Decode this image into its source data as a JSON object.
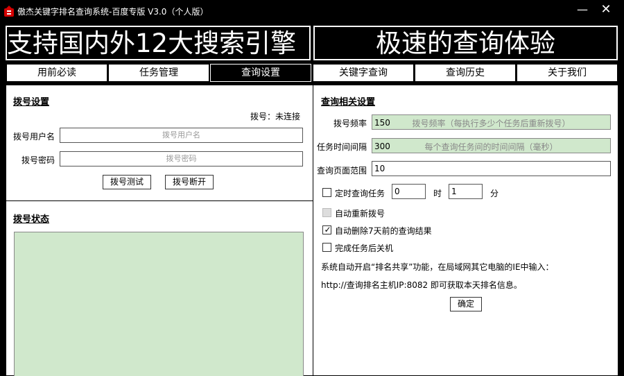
{
  "window": {
    "title": "傲杰关键字排名查询系统-百度专版 V3.0（个人版）",
    "minimize": "—",
    "close": "✕"
  },
  "banner": {
    "left_text": "支持国内外12大搜索引擎",
    "right_text": "极速的查询体验"
  },
  "tabs": [
    {
      "label": "用前必读"
    },
    {
      "label": "任务管理"
    },
    {
      "label": "查询设置"
    },
    {
      "label": "关键字查询"
    },
    {
      "label": "查询历史"
    },
    {
      "label": "关于我们"
    }
  ],
  "active_tab": "查询设置",
  "dial": {
    "title": "拨号设置",
    "status": "拨号：未连接",
    "username_label": "拨号用户名",
    "username_placeholder": "拨号用户名",
    "password_label": "拨号密码",
    "password_placeholder": "拨号密码",
    "test_button": "拨号测试",
    "disconnect_button": "拨号断开"
  },
  "dial_status": {
    "title": "拨号状态"
  },
  "query": {
    "title": "查询相关设置",
    "freq_label": "拨号频率",
    "freq_value": "150",
    "freq_hint": "拨号频率（每执行多少个任务后重新拨号）",
    "interval_label": "任务时间间隔",
    "interval_value": "300",
    "interval_hint": "每个查询任务间的时间间隔（毫秒）",
    "range_label": "查询页面范围",
    "range_value": "10",
    "timed_label": "定时查询任务",
    "hour_value": "0",
    "hour_unit": "时",
    "minute_value": "1",
    "minute_unit": "分",
    "redial_label": "自动重新拨号",
    "delete_label": "自动删除7天前的查询结果",
    "shutdown_label": "完成任务后关机",
    "share_note": "系统自动开启“排名共享”功能，在局域网其它电脑的IE中输入：",
    "share_url": "http://查询排名主机IP:8082  即可获取本天排名信息。",
    "ok_button": "确定",
    "checkbox_states": {
      "timed": false,
      "redial": false,
      "delete": true,
      "shutdown": false
    }
  },
  "colors": {
    "background": "#000000",
    "panel": "#ffffff",
    "field_green": "#d0e8cc",
    "logo_red": "#d40000"
  }
}
